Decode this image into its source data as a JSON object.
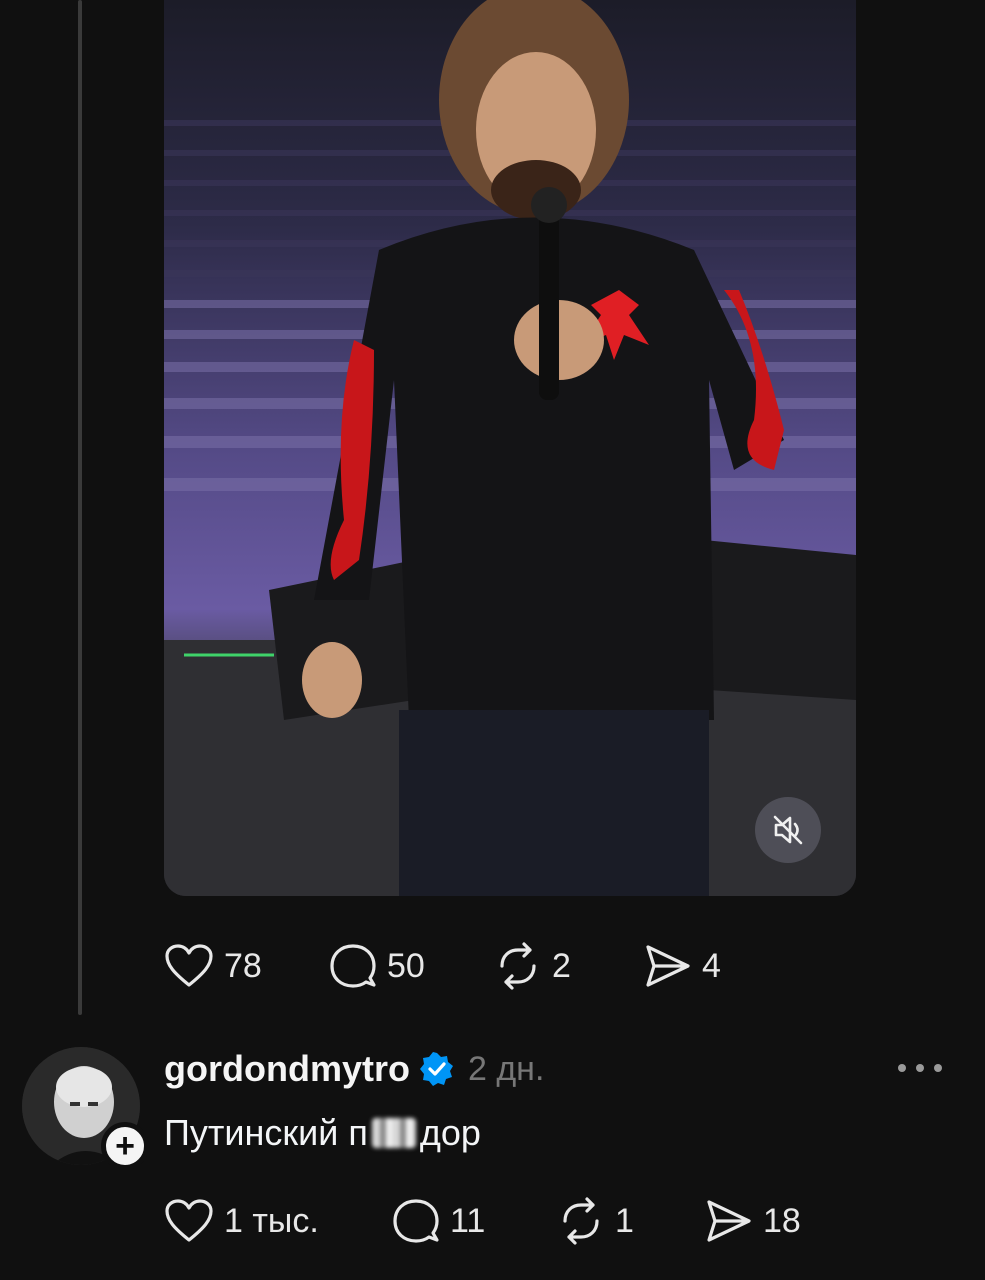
{
  "post1": {
    "media": {
      "description_icon": "video-person-on-stage",
      "mute_icon": "muted-speaker-icon"
    },
    "actions": {
      "likes": "78",
      "comments": "50",
      "reposts": "2",
      "shares": "4"
    }
  },
  "reply": {
    "username": "gordondmytro",
    "verified": true,
    "timestamp": "2 дн.",
    "text_before": "Путинский п",
    "text_after": "дор",
    "actions": {
      "likes": "1 тыс.",
      "comments": "11",
      "reposts": "1",
      "shares": "18"
    }
  },
  "colors": {
    "background": "#101010",
    "verified_blue": "#0095f6",
    "text_secondary": "#777777"
  }
}
